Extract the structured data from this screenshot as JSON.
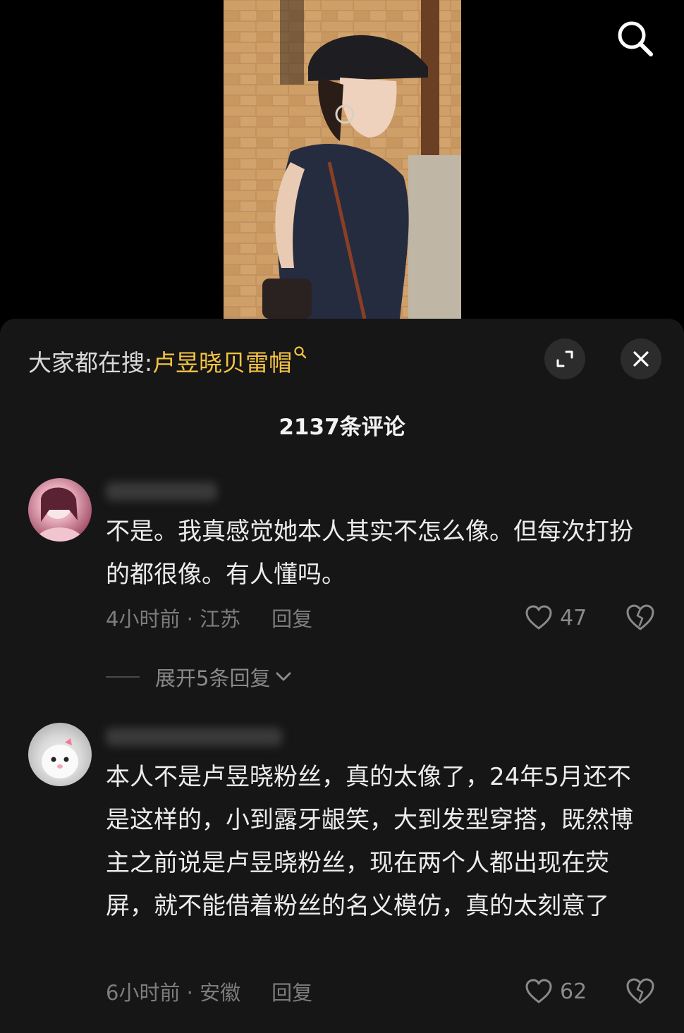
{
  "video": {
    "search_icon": "search-icon"
  },
  "panel": {
    "hot_search_prefix": "大家都在搜:",
    "hot_search_keyword": "卢昱晓贝雷帽",
    "expand_icon": "expand-icon",
    "close_icon": "close-icon",
    "comment_count": "2137条评论"
  },
  "comments": [
    {
      "text": "不是。我真感觉她本人其实不怎么像。但每次打扮的都很像。有人懂吗。",
      "time_location": "4小时前 · 江苏",
      "reply_label": "回复",
      "likes": "47",
      "expand_replies": "展开5条回复"
    },
    {
      "text": "本人不是卢昱晓粉丝，真的太像了，24年5月还不是这样的，小到露牙龈笑，大到发型穿搭，既然博主之前说是卢昱晓粉丝，现在两个人都出现在荧屏，就不能借着粉丝的名义模仿，真的太刻意了",
      "time_location": "6小时前 · 安徽",
      "reply_label": "回复",
      "likes": "62"
    }
  ],
  "colors": {
    "keyword": "#f5c443",
    "panel_bg": "#161616",
    "meta_text": "#7d7d7d"
  }
}
